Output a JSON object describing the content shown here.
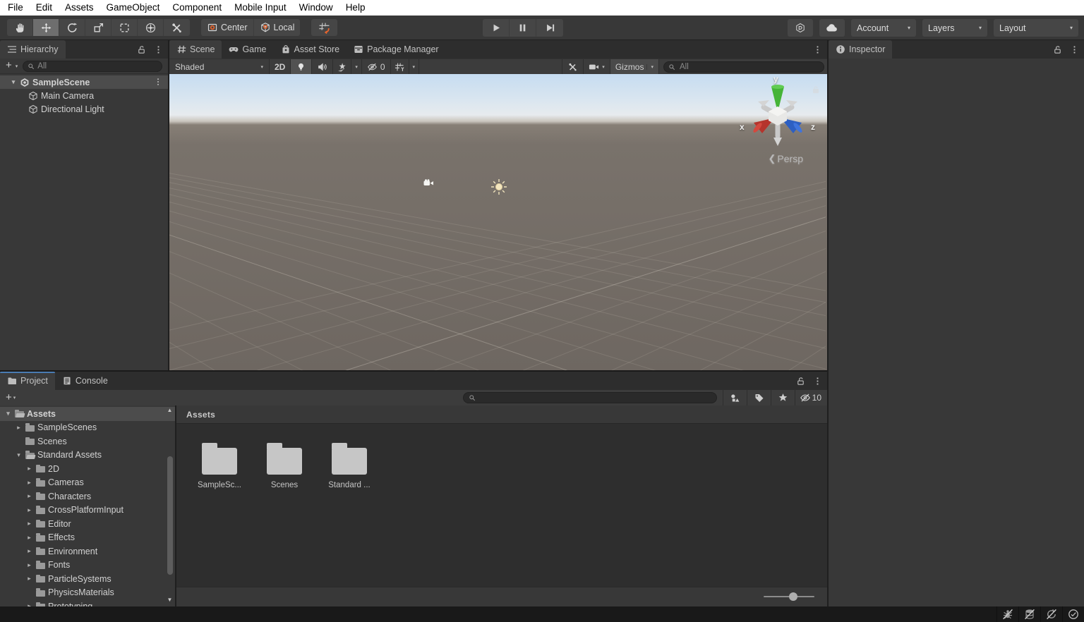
{
  "menubar": {
    "items": [
      "File",
      "Edit",
      "Assets",
      "GameObject",
      "Component",
      "Mobile Input",
      "Window",
      "Help"
    ]
  },
  "toolbar": {
    "tools": [
      {
        "name": "pan-tool-button",
        "icon": "hand",
        "selected": false
      },
      {
        "name": "move-tool-button",
        "icon": "move",
        "selected": true
      },
      {
        "name": "rotate-tool-button",
        "icon": "rotate",
        "selected": false
      },
      {
        "name": "scale-tool-button",
        "icon": "scale",
        "selected": false
      },
      {
        "name": "rect-tool-button",
        "icon": "rect",
        "selected": false
      },
      {
        "name": "transform-tool-button",
        "icon": "transform",
        "selected": false
      },
      {
        "name": "custom-tools-button",
        "icon": "tools",
        "selected": false
      }
    ],
    "pivot_buttons": [
      {
        "name": "pivot-center-button",
        "icon": "center",
        "label": "Center"
      },
      {
        "name": "handle-rotation-local-button",
        "icon": "local",
        "label": "Local"
      }
    ],
    "playback": [
      {
        "name": "play-button",
        "icon": "play"
      },
      {
        "name": "pause-button",
        "icon": "pause"
      },
      {
        "name": "step-button",
        "icon": "step"
      }
    ],
    "right_buttons": [
      {
        "name": "version-control-button",
        "icon": "plastic"
      },
      {
        "name": "cloud-services-button",
        "icon": "cloud"
      }
    ],
    "dropdowns": [
      {
        "name": "account-dropdown",
        "label": "Account",
        "w": "w-acct"
      },
      {
        "name": "layers-dropdown",
        "label": "Layers",
        "w": "w-lay"
      },
      {
        "name": "layout-dropdown",
        "label": "Layout",
        "w": "w-layout"
      }
    ]
  },
  "hierarchy": {
    "title": "Hierarchy",
    "search_placeholder": "All",
    "scene": {
      "label": "SampleScene"
    },
    "items": [
      {
        "label": "Main Camera"
      },
      {
        "label": "Directional Light"
      }
    ]
  },
  "scene_view": {
    "tabs": [
      {
        "label": "Scene",
        "icon": "scene",
        "active": true
      },
      {
        "label": "Game",
        "icon": "game",
        "active": false
      },
      {
        "label": "Asset Store",
        "icon": "store",
        "active": false
      },
      {
        "label": "Package Manager",
        "icon": "package",
        "active": false
      }
    ],
    "shading_mode": "Shaded",
    "toggle_2d": "2D",
    "hidden_objects_count": "0",
    "gizmos_label": "Gizmos",
    "search_placeholder": "All",
    "projection_label": "Persp",
    "axis_labels": {
      "x": "x",
      "y": "y",
      "z": "z"
    }
  },
  "inspector": {
    "title": "Inspector"
  },
  "project": {
    "tabs": [
      {
        "label": "Project",
        "icon": "folder",
        "active": true
      },
      {
        "label": "Console",
        "icon": "console",
        "active": false
      }
    ],
    "search_placeholder": "",
    "hidden_count": "10",
    "toolbar_icons": [
      {
        "name": "search-by-type-button",
        "icon": "shapes"
      },
      {
        "name": "search-by-label-button",
        "icon": "tag"
      },
      {
        "name": "favorites-button",
        "icon": "star"
      }
    ],
    "tree": [
      {
        "label": "Assets",
        "depth": 0,
        "arrow": "open",
        "open": true,
        "selected": true,
        "bold": true
      },
      {
        "label": "SampleScenes",
        "depth": 1,
        "arrow": "closed",
        "open": false,
        "selected": false,
        "bold": false
      },
      {
        "label": "Scenes",
        "depth": 1,
        "arrow": "none",
        "open": false,
        "selected": false,
        "bold": false
      },
      {
        "label": "Standard Assets",
        "depth": 1,
        "arrow": "open",
        "open": true,
        "selected": false,
        "bold": false
      },
      {
        "label": "2D",
        "depth": 2,
        "arrow": "closed",
        "open": false,
        "selected": false,
        "bold": false
      },
      {
        "label": "Cameras",
        "depth": 2,
        "arrow": "closed",
        "open": false,
        "selected": false,
        "bold": false
      },
      {
        "label": "Characters",
        "depth": 2,
        "arrow": "closed",
        "open": false,
        "selected": false,
        "bold": false
      },
      {
        "label": "CrossPlatformInput",
        "depth": 2,
        "arrow": "closed",
        "open": false,
        "selected": false,
        "bold": false
      },
      {
        "label": "Editor",
        "depth": 2,
        "arrow": "closed",
        "open": false,
        "selected": false,
        "bold": false
      },
      {
        "label": "Effects",
        "depth": 2,
        "arrow": "closed",
        "open": false,
        "selected": false,
        "bold": false
      },
      {
        "label": "Environment",
        "depth": 2,
        "arrow": "closed",
        "open": false,
        "selected": false,
        "bold": false
      },
      {
        "label": "Fonts",
        "depth": 2,
        "arrow": "closed",
        "open": false,
        "selected": false,
        "bold": false
      },
      {
        "label": "ParticleSystems",
        "depth": 2,
        "arrow": "closed",
        "open": false,
        "selected": false,
        "bold": false
      },
      {
        "label": "PhysicsMaterials",
        "depth": 2,
        "arrow": "none",
        "open": false,
        "selected": false,
        "bold": false
      },
      {
        "label": "Prototyping",
        "depth": 2,
        "arrow": "closed",
        "open": false,
        "selected": false,
        "bold": false
      }
    ],
    "content_header": "Assets",
    "folders": [
      {
        "label": "SampleSc..."
      },
      {
        "label": "Scenes"
      },
      {
        "label": "Standard ..."
      }
    ]
  },
  "statusbar": {
    "icons": [
      {
        "name": "debugger-detached-icon",
        "icon": "bug"
      },
      {
        "name": "cache-server-disabled-icon",
        "icon": "cache"
      },
      {
        "name": "auto-refresh-disabled-icon",
        "icon": "refresh"
      },
      {
        "name": "status-ok-icon",
        "icon": "ok"
      }
    ]
  },
  "colors": {
    "accent_blue": "#4a7cb3",
    "selection_gray": "#4c4c4c",
    "axis_x_red": "#b5342c",
    "axis_y_green": "#45b437",
    "axis_z_blue": "#2d5fc2",
    "pivot_orange": "#e8642d",
    "sky_top": "#c6dcf1",
    "ground": "#6e6761"
  }
}
